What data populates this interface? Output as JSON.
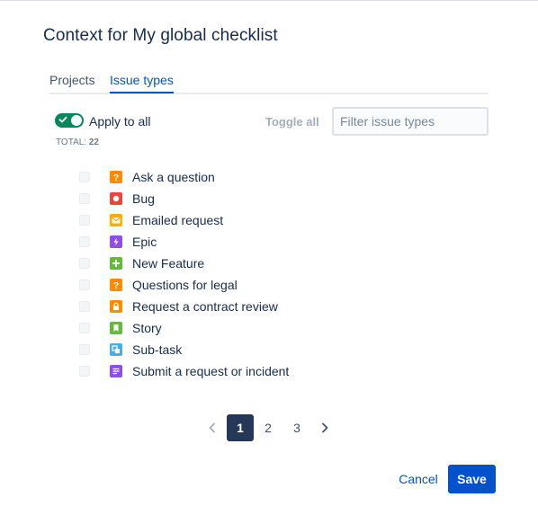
{
  "dialog": {
    "title": "Context for My global checklist"
  },
  "tabs": [
    {
      "label": "Projects"
    },
    {
      "label": "Issue types"
    }
  ],
  "apply_to_all": {
    "label": "Apply to all",
    "enabled": true
  },
  "total": {
    "label": "TOTAL:",
    "count": "22"
  },
  "toggle_all_label": "Toggle all",
  "filter": {
    "placeholder": "Filter issue types",
    "value": ""
  },
  "issue_types": [
    {
      "label": "Ask a question",
      "icon": "question-icon",
      "color": "#ff8b00"
    },
    {
      "label": "Bug",
      "icon": "bug-icon",
      "color": "#e5493a"
    },
    {
      "label": "Emailed request",
      "icon": "email-icon",
      "color": "#ffab00"
    },
    {
      "label": "Epic",
      "icon": "epic-icon",
      "color": "#904ee2"
    },
    {
      "label": "New Feature",
      "icon": "new-feature-icon",
      "color": "#63ba3c"
    },
    {
      "label": "Questions for legal",
      "icon": "question-icon",
      "color": "#ff8b00"
    },
    {
      "label": "Request a contract review",
      "icon": "lock-icon",
      "color": "#ff8b00"
    },
    {
      "label": "Story",
      "icon": "story-icon",
      "color": "#63ba3c"
    },
    {
      "label": "Sub-task",
      "icon": "subtask-icon",
      "color": "#4bade8"
    },
    {
      "label": "Submit a request or incident",
      "icon": "request-icon",
      "color": "#904ee2"
    }
  ],
  "pagination": {
    "pages": [
      "1",
      "2",
      "3"
    ],
    "current": "1"
  },
  "footer": {
    "cancel_label": "Cancel",
    "save_label": "Save"
  }
}
